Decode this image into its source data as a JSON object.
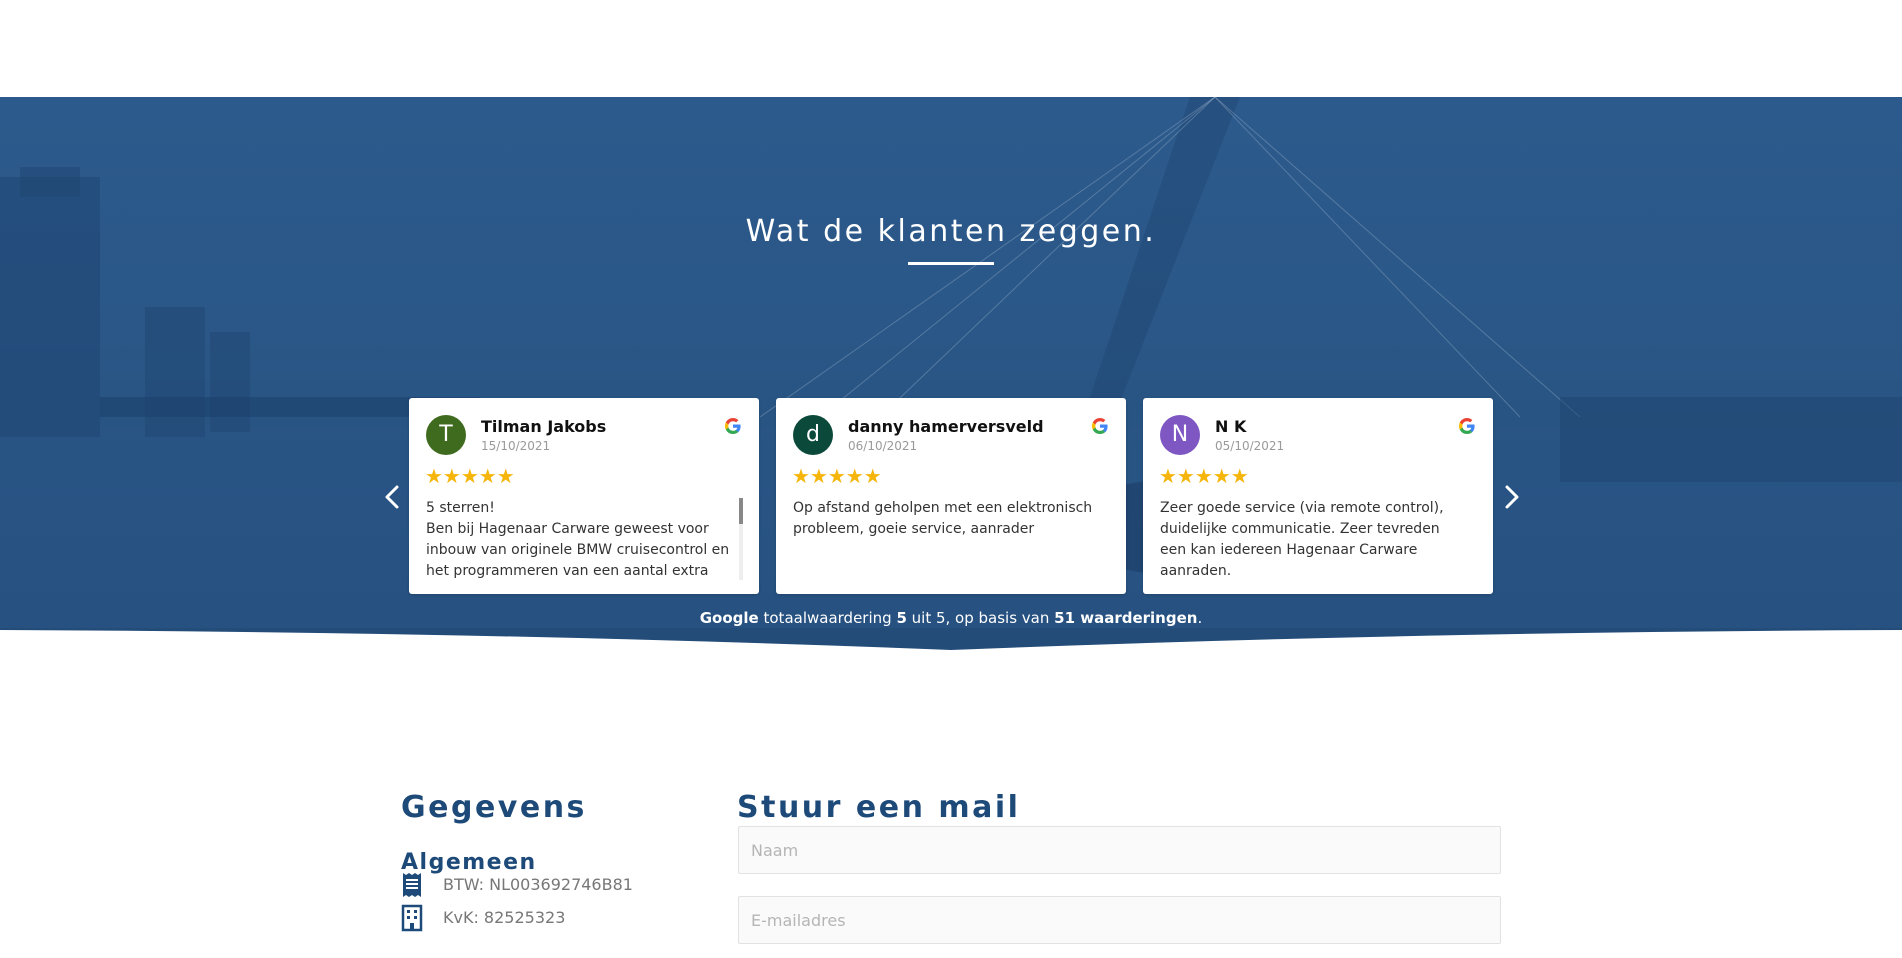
{
  "reviews_section": {
    "title": "Wat de klanten zeggen.",
    "reviews": [
      {
        "initial": "T",
        "name": "Tilman Jakobs",
        "date": "15/10/2021",
        "stars": "★★★★★",
        "rating": 5,
        "text": "5 sterren!\nBen bij Hagenaar Carware geweest voor inbouw van originele BMW cruisecontrol en het programmeren van een aantal extra",
        "avatar_color": "#3f6b1f"
      },
      {
        "initial": "d",
        "name": "danny hamerversveld",
        "date": "06/10/2021",
        "stars": "★★★★★",
        "rating": 5,
        "text": "Op afstand geholpen met een elektronisch probleem, goeie service, aanrader",
        "avatar_color": "#0b4a3a"
      },
      {
        "initial": "N",
        "name": "N K",
        "date": "05/10/2021",
        "stars": "★★★★★",
        "rating": 5,
        "text": "Zeer goede service (via remote control), duidelijke communicatie. Zeer tevreden een kan iedereen Hagenaar Carware aanraden.",
        "avatar_color": "#7e57c2"
      }
    ],
    "summary": {
      "brand": "Google",
      "text_1": " totaalwaardering ",
      "score": "5",
      "text_2": " uit 5, op basis van ",
      "count": "51 waarderingen",
      "text_3": "."
    },
    "icons": {
      "prev": "chevron-left-icon",
      "next": "chevron-right-icon",
      "source": "google-icon"
    }
  },
  "details": {
    "title": "Gegevens",
    "subtitle": "Algemeen",
    "items": [
      {
        "icon": "receipt-icon",
        "text": "BTW: NL003692746B81"
      },
      {
        "icon": "building-icon",
        "text": "KvK: 82525323"
      }
    ]
  },
  "contact_form": {
    "title": "Stuur een mail",
    "name_placeholder": "Naam",
    "email_placeholder": "E-mailadres",
    "name_value": "",
    "email_value": ""
  },
  "colors": {
    "brand_blue": "#1d4a78",
    "hero_blue": "#2a5787",
    "star": "#f5b50a"
  }
}
